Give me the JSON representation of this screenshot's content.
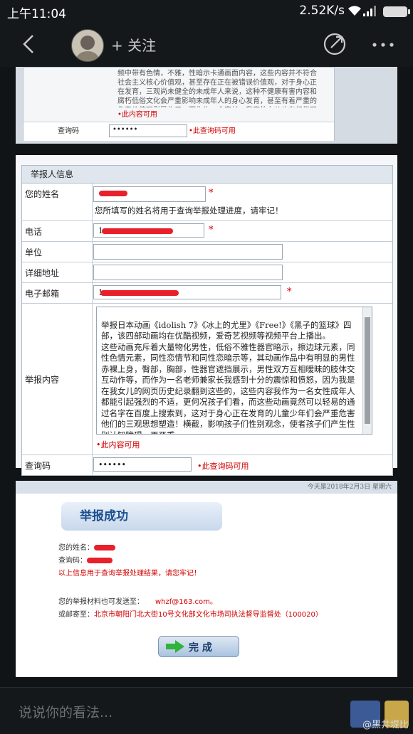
{
  "status_bar": {
    "time": "上午11:04",
    "network_speed": "2.52K/s"
  },
  "nav": {
    "follow_label": "+ 关注"
  },
  "screenshot1": {
    "content_text": "频中带有色情，不雅，性暗示卡通画面内容，这些内容并不符合社会主义核心价值观，甚至存在正在被错误价值观，对于身心正在发育，三观尚未健全的未成年人来说，这种不健康有害内容和腐朽低俗文化会严重影响未成年人的身心发育，甚至有着严重的危害价值观引导作用。而作为一个家长，我家的女儿也在经常观看这个日剧",
    "available": "•此内容可用",
    "code_label": "查询码",
    "code_value": "••••••",
    "code_available": "•此查询码可用"
  },
  "form": {
    "section_header": "举报人信息",
    "name_label": "您的姓名",
    "name_hint": "您所填写的姓名将用于查询举报处理进度，请牢记！",
    "phone_label": "电话",
    "phone_value": "1",
    "unit_label": "单位",
    "address_label": "详细地址",
    "email_label": "电子邮箱",
    "email_value": "1",
    "required_mark": "*",
    "content_label": "举报内容",
    "content_text": "举报日本动画《idolish 7》《冰上的尤里》《Free!》《黑子的篮球》四部，该四部动画均在优酷视频，爱奇艺视频等视频平台上播出。\n这些动画充斥着大量物化男性，低俗不雅性器官暗示，擦边球元素，同性色情元素，同性恋情节和同性恋暗示等，其动画作品中有明显的男性赤裸上身，臀部，胸部，性器官遮挡展示，男性双方互相暧昧的肢体交互动作等，而作为一名老师兼家长我感到十分的震惊和愤怒，因为我是在我女儿的网页历史纪录翻到这些的，这些内容我作为一名女性成年人都能引起强烈的不适，更何况孩子们看，而这些动画竟然可以轻易的通过名字在百度上搜索到，这对于身心正在发育的儿童少年们会严重危害他们的三观思想塑造！横截，影响孩子们性别观念，使者孩子们产生性别认知障碍，更严重",
    "content_available": "•此内容可用",
    "code_label": "查询码",
    "code_value": "••••••",
    "code_available": "•此查询码可用"
  },
  "success": {
    "top_text": "今天是2018年2月3日 星期六",
    "title": "举报成功",
    "name_label": "您的姓名：",
    "code_label": "查询码：",
    "notice": "以上信息用于查询举报处理结果，请您牢记！",
    "send_label": "您的举报材料也可发送至：",
    "email": "whzf@163.com。",
    "mail_label": "或邮寄至：",
    "address": "北京市朝阳门北大街10号文化部文化市场司执法督导监督处（100020）",
    "done_label": "完 成"
  },
  "comment": {
    "placeholder": "说说你的看法...",
    "watermark": "@黑井堤比"
  }
}
